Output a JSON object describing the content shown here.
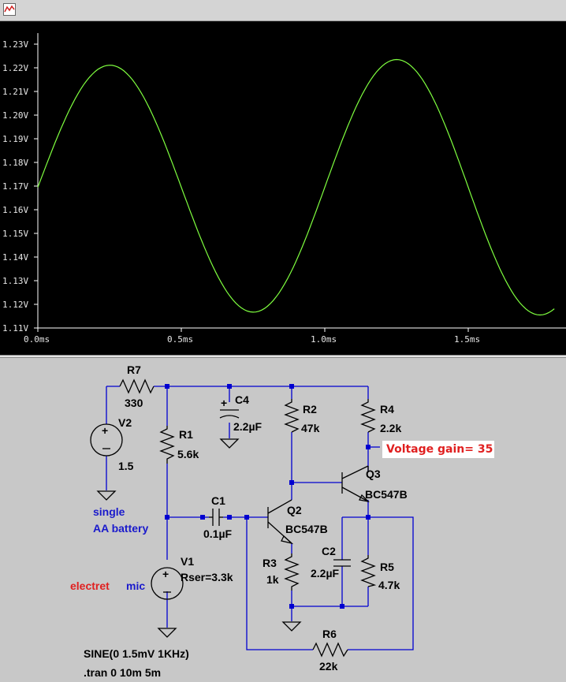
{
  "plot": {
    "y_ticks": [
      "1.11V",
      "1.12V",
      "1.13V",
      "1.14V",
      "1.15V",
      "1.16V",
      "1.17V",
      "1.18V",
      "1.19V",
      "1.20V",
      "1.21V",
      "1.22V",
      "1.23V"
    ],
    "x_ticks": [
      "0.0ms",
      "0.5ms",
      "1.0ms",
      "1.5ms"
    ],
    "trace_color": "#7fff3f"
  },
  "chart_data": {
    "type": "line",
    "xlim": [
      0,
      1.8
    ],
    "ylim": [
      1.11,
      1.23
    ],
    "x": [
      0.0,
      0.125,
      0.25,
      0.375,
      0.5,
      0.625,
      0.75,
      0.875,
      1.0,
      1.125,
      1.25,
      1.375,
      1.5,
      1.625,
      1.75,
      1.8
    ],
    "series": [
      {
        "values": [
          1.168,
          1.204,
          1.22,
          1.205,
          1.169,
          1.133,
          1.118,
          1.132,
          1.17,
          1.208,
          1.224,
          1.208,
          1.17,
          1.131,
          1.115,
          1.121
        ]
      }
    ],
    "grid": false
  },
  "schematic": {
    "r7": {
      "name": "R7",
      "value": "330"
    },
    "c4": {
      "name": "C4",
      "value": "2.2µF",
      "polarity": "+"
    },
    "r2": {
      "name": "R2",
      "value": "47k"
    },
    "r4": {
      "name": "R4",
      "value": "2.2k"
    },
    "v2": {
      "name": "V2",
      "value": "1.5"
    },
    "r1": {
      "name": "R1",
      "value": "5.6k"
    },
    "q3": {
      "name": "Q3",
      "model": "BC547B"
    },
    "c1": {
      "name": "C1",
      "value": "0.1µF"
    },
    "q2": {
      "name": "Q2",
      "model": "BC547B"
    },
    "note_single": "single",
    "note_battery": "AA battery",
    "v1": {
      "name": "V1",
      "value": "Rser=3.3k"
    },
    "c2": {
      "name": "C2",
      "value": "2.2µF"
    },
    "r3": {
      "name": "R3",
      "value": "1k"
    },
    "r5": {
      "name": "R5",
      "value": "4.7k"
    },
    "mic_word1": "electret",
    "mic_word2": "mic",
    "r6": {
      "name": "R6",
      "value": "22k"
    },
    "sine_directive": "SINE(0 1.5mV 1KHz)",
    "tran_directive": ".tran 0 10m 5m",
    "gain_label": "Voltage gain= 35"
  }
}
